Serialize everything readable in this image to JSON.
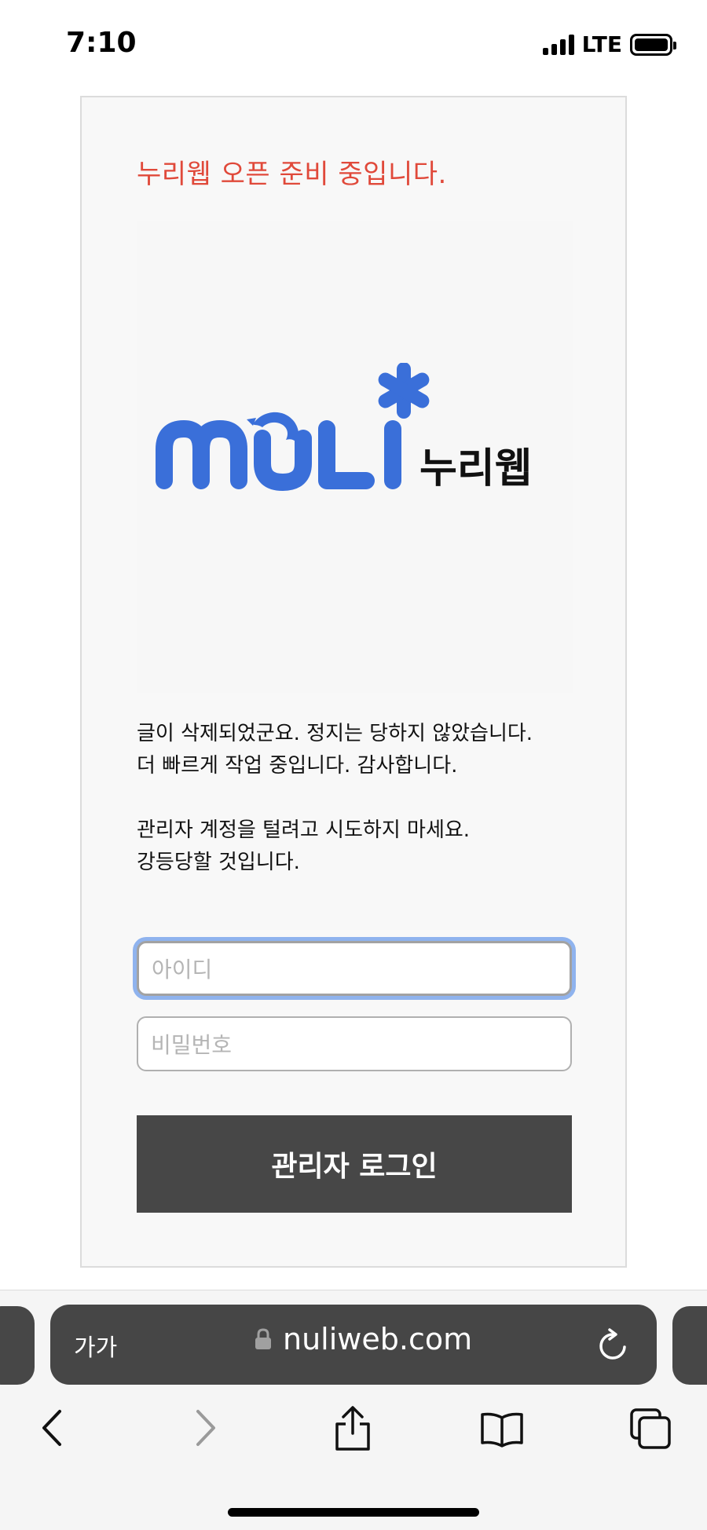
{
  "status_bar": {
    "time": "7:10",
    "network": "LTE"
  },
  "page": {
    "notice_title": "누리웹 오픈 준비 중입니다.",
    "logo": {
      "wordmark": "NULI",
      "korean_name": "누리웹",
      "brand_color": "#3a6fd9"
    },
    "message_lines": [
      "글이 삭제되었군요. 정지는 당하지 않았습니다.",
      "더 빠르게 작업 중입니다. 감사합니다.",
      "관리자 계정을 털려고 시도하지 마세요.",
      "강등당할 것입니다."
    ],
    "id_placeholder": "아이디",
    "password_placeholder": "비밀번호",
    "login_button": "관리자 로그인"
  },
  "browser": {
    "text_size_button": "가가",
    "url": "nuliweb.com"
  },
  "colors": {
    "notice": "#e0493a",
    "button_bg": "#474747",
    "focus_ring": "#8fb3ee"
  }
}
